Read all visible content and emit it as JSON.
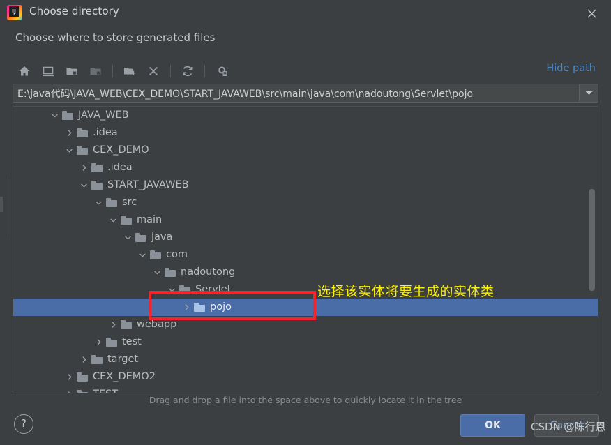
{
  "window": {
    "title": "Choose directory",
    "subtitle": "Choose where to store generated files",
    "close_icon": "close-icon",
    "app_logo": "intellij-idea-logo"
  },
  "toolbar": {
    "buttons": [
      {
        "name": "home-icon",
        "label": "Home",
        "enabled": true
      },
      {
        "name": "desktop-icon",
        "label": "Desktop",
        "enabled": true
      },
      {
        "name": "project-folder-icon",
        "label": "Project Directory",
        "enabled": true
      },
      {
        "name": "module-folder-icon",
        "label": "Module Directory",
        "enabled": false
      },
      {
        "name": "new-folder-icon",
        "label": "New Folder",
        "enabled": true
      },
      {
        "name": "delete-icon",
        "label": "Delete",
        "enabled": true
      },
      {
        "name": "refresh-icon",
        "label": "Refresh",
        "enabled": true
      },
      {
        "name": "show-hidden-icon",
        "label": "Show Hidden Files",
        "enabled": true
      }
    ],
    "hide_path_label": "Hide path"
  },
  "path_field": {
    "value": "E:\\java代码\\JAVA_WEB\\CEX_DEMO\\START_JAVAWEB\\src\\main\\java\\com\\nadoutong\\Servlet\\pojo",
    "placeholder": "",
    "dropdown_icon": "chevron-down-icon"
  },
  "tree": {
    "rows": [
      {
        "label": "JAVA_WEB",
        "depth": 2,
        "arrow": "down",
        "selected": false
      },
      {
        "label": ".idea",
        "depth": 3,
        "arrow": "right",
        "selected": false
      },
      {
        "label": "CEX_DEMO",
        "depth": 3,
        "arrow": "down",
        "selected": false
      },
      {
        "label": ".idea",
        "depth": 4,
        "arrow": "right",
        "selected": false
      },
      {
        "label": "START_JAVAWEB",
        "depth": 4,
        "arrow": "down",
        "selected": false
      },
      {
        "label": "src",
        "depth": 5,
        "arrow": "down",
        "selected": false
      },
      {
        "label": "main",
        "depth": 6,
        "arrow": "down",
        "selected": false
      },
      {
        "label": "java",
        "depth": 7,
        "arrow": "down",
        "selected": false
      },
      {
        "label": "com",
        "depth": 8,
        "arrow": "down",
        "selected": false
      },
      {
        "label": "nadoutong",
        "depth": 9,
        "arrow": "down",
        "selected": false
      },
      {
        "label": "Servlet",
        "depth": 10,
        "arrow": "down",
        "selected": false
      },
      {
        "label": "pojo",
        "depth": 11,
        "arrow": "right",
        "selected": true
      },
      {
        "label": "webapp",
        "depth": 6,
        "arrow": "right",
        "selected": false
      },
      {
        "label": "test",
        "depth": 5,
        "arrow": "right",
        "selected": false
      },
      {
        "label": "target",
        "depth": 4,
        "arrow": "right",
        "selected": false
      },
      {
        "label": "CEX_DEMO2",
        "depth": 3,
        "arrow": "right",
        "selected": false
      },
      {
        "label": "TEST",
        "depth": 3,
        "arrow": "right",
        "selected": false
      }
    ]
  },
  "hint": "Drag and drop a file into the space above to quickly locate it in the tree",
  "footer": {
    "help_label": "?",
    "ok_label": "OK",
    "cancel_label": "Cancel"
  },
  "annotations": {
    "callout_text": "选择该实体将要生成的实体类",
    "callout_color": "#fbf009",
    "box_color": "#f5232b",
    "watermark": "CSDN @陈行恩"
  },
  "colors": {
    "background": "#3c3f41",
    "selection": "#4a6da7",
    "link": "#4a88c7",
    "text": "#bbbbbb"
  }
}
